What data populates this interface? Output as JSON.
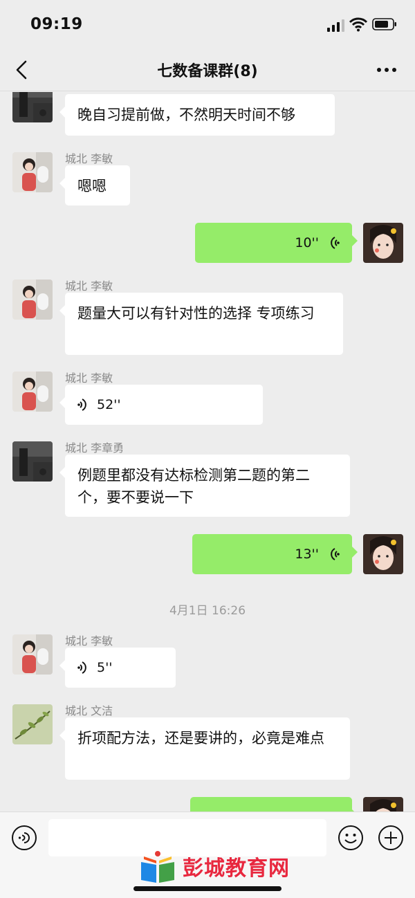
{
  "status_bar": {
    "time": "09:19"
  },
  "nav": {
    "title": "七数备课群(8)"
  },
  "messages": {
    "m1": {
      "text": "晚自习提前做，不然明天时间不够"
    },
    "m2": {
      "sender": "城北 李敏",
      "text": "嗯嗯"
    },
    "m3": {
      "duration": "10''"
    },
    "m4": {
      "sender": "城北 李敏",
      "text": "题量大可以有针对性的选择  专项练习"
    },
    "m5": {
      "sender": "城北 李敏",
      "duration": "52''"
    },
    "m6": {
      "sender": "城北 李章勇",
      "text": "例题里都没有达标检测第二题的第二个，要不要说一下"
    },
    "m7": {
      "duration": "13''"
    },
    "m8": {
      "sender": "城北 李敏",
      "duration": "5''"
    },
    "m9": {
      "sender": "城北 文洁",
      "text": "折项配方法，还是要讲的，必竟是难点"
    }
  },
  "timestamp": "4月1日 16:26",
  "watermark": {
    "text": "彭城教育网"
  },
  "colors": {
    "background": "#ededed",
    "bubble_self": "#95ec69",
    "bubble_other": "#ffffff",
    "watermark": "#e8283f"
  }
}
